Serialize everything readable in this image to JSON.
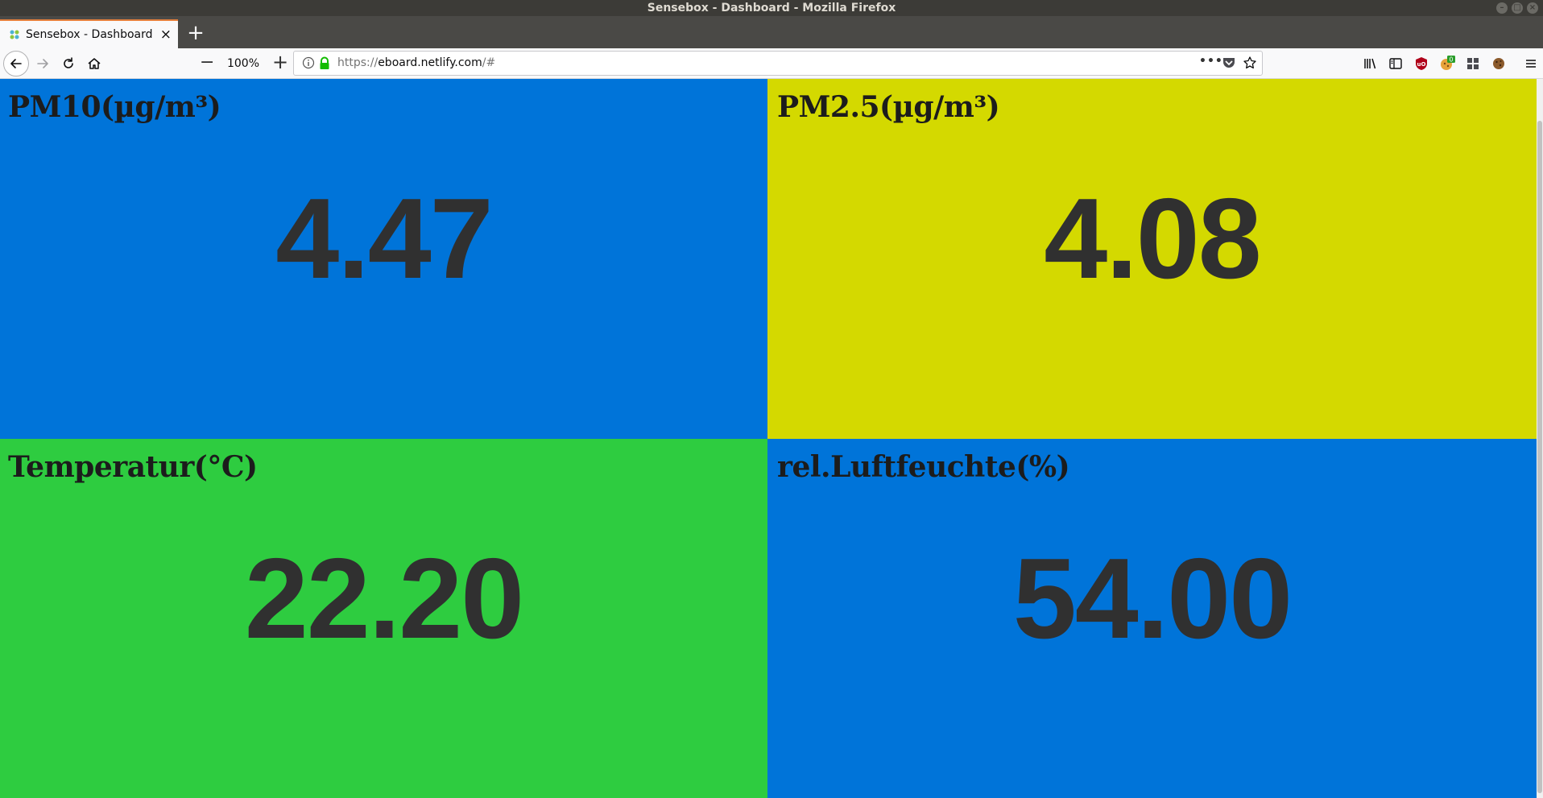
{
  "window": {
    "title": "Sensebox - Dashboard - Mozilla Firefox"
  },
  "tab": {
    "title": "Sensebox - Dashboard",
    "close_glyph": "×",
    "new_tab_glyph": "+"
  },
  "toolbar": {
    "zoom_level": "100%",
    "zoom_minus": "−",
    "zoom_plus": "+",
    "url_scheme": "https://",
    "url_host": "eboard.netlify.com",
    "url_path": "/#",
    "page_actions_glyph": "•••",
    "addon_badge": "0"
  },
  "tiles": [
    {
      "label": "PM10(µg/m³)",
      "value": "4.47",
      "color": "#0074d9"
    },
    {
      "label": "PM2.5(µg/m³)",
      "value": "4.08",
      "color": "#d4d900"
    },
    {
      "label": "Temperatur(°C)",
      "value": "22.20",
      "color": "#2ecc40"
    },
    {
      "label": "rel.Luftfeuchte(%)",
      "value": "54.00",
      "color": "#0074d9"
    }
  ],
  "colors": {
    "titlebar_bg": "#3c3b37",
    "tab_accent": "#e6803c",
    "value_text": "#303030"
  }
}
